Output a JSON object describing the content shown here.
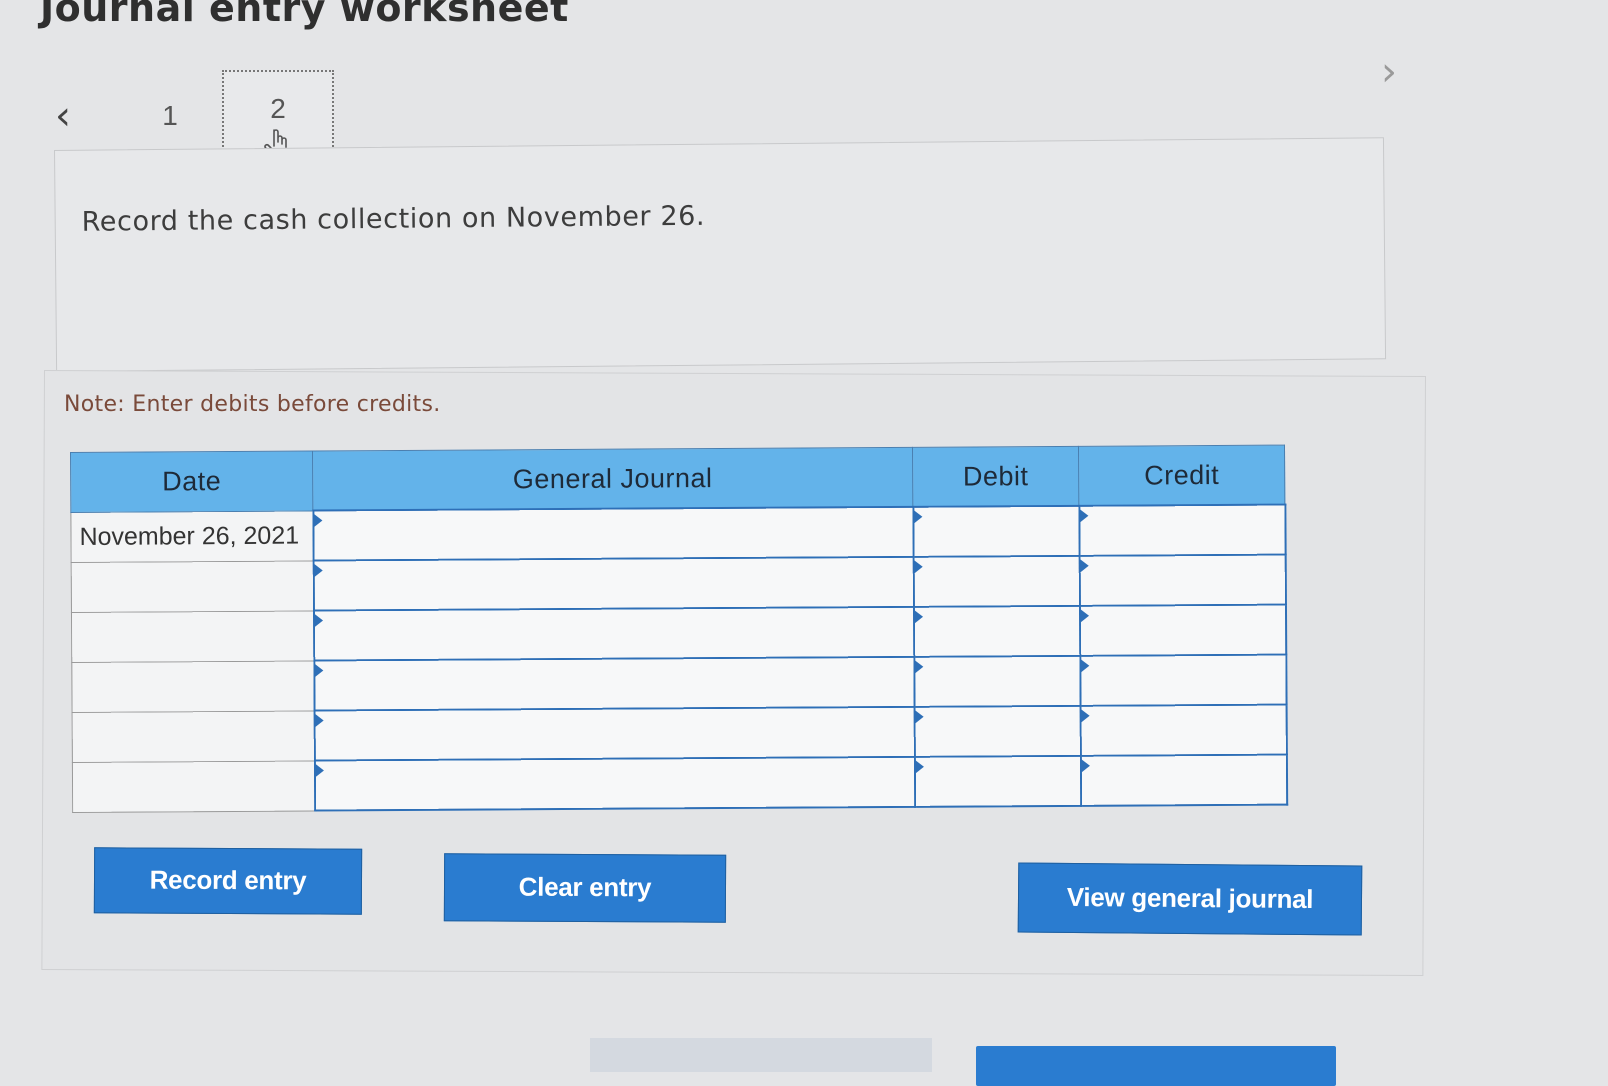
{
  "page": {
    "title": "Journal entry worksheet"
  },
  "navigation": {
    "prev_icon": "chevron-left-icon",
    "next_icon": "chevron-right-icon",
    "steps": [
      {
        "label": "1",
        "active": false
      },
      {
        "label": "2",
        "active": true
      }
    ]
  },
  "instruction": {
    "text": "Record the cash collection on November 26."
  },
  "note": {
    "text": "Note: Enter debits before credits."
  },
  "journal": {
    "headers": {
      "date": "Date",
      "account": "General Journal",
      "debit": "Debit",
      "credit": "Credit"
    },
    "rows": [
      {
        "date": "November 26, 2021",
        "account": "",
        "debit": "",
        "credit": ""
      },
      {
        "date": "",
        "account": "",
        "debit": "",
        "credit": ""
      },
      {
        "date": "",
        "account": "",
        "debit": "",
        "credit": ""
      },
      {
        "date": "",
        "account": "",
        "debit": "",
        "credit": ""
      },
      {
        "date": "",
        "account": "",
        "debit": "",
        "credit": ""
      },
      {
        "date": "",
        "account": "",
        "debit": "",
        "credit": ""
      }
    ]
  },
  "buttons": {
    "record": "Record entry",
    "clear": "Clear entry",
    "view": "View general journal"
  },
  "colors": {
    "header_bg": "#63b3ea",
    "button_bg": "#2a7cd0",
    "cell_border": "#2e6fb7"
  }
}
